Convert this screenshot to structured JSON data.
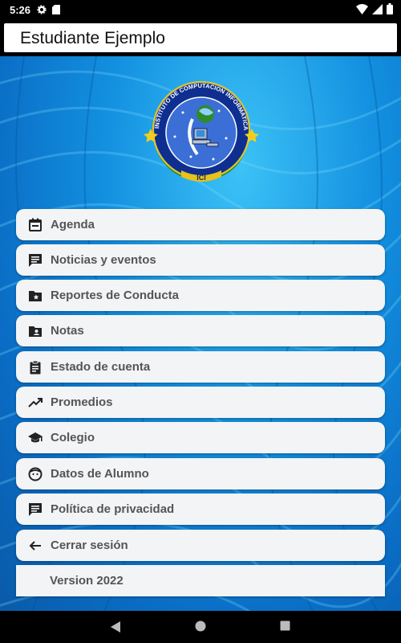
{
  "status_bar": {
    "time": "5:26"
  },
  "header": {
    "title": "Estudiante Ejemplo"
  },
  "logo": {
    "ring_text": "INSTITUTO DE COMPUTACION INFORMATICA",
    "badge_text": "ICI"
  },
  "menu": [
    {
      "label": "Agenda",
      "icon": "calendar-icon"
    },
    {
      "label": "Noticias y eventos",
      "icon": "chat-icon"
    },
    {
      "label": "Reportes de Conducta",
      "icon": "folder-star-icon"
    },
    {
      "label": "Notas",
      "icon": "folder-account-icon"
    },
    {
      "label": "Estado de cuenta",
      "icon": "clipboard-icon"
    },
    {
      "label": "Promedios",
      "icon": "trending-up-icon"
    },
    {
      "label": "Colegio",
      "icon": "school-icon"
    },
    {
      "label": "Datos de Alumno",
      "icon": "face-icon"
    },
    {
      "label": "Política de privacidad",
      "icon": "chat-icon"
    },
    {
      "label": "Cerrar sesión",
      "icon": "arrow-back-icon"
    },
    {
      "label": "Version 2022",
      "icon": ""
    }
  ],
  "colors": {
    "background": "#1390e0",
    "item_bg": "#f2f4f5",
    "item_text": "#555555"
  }
}
